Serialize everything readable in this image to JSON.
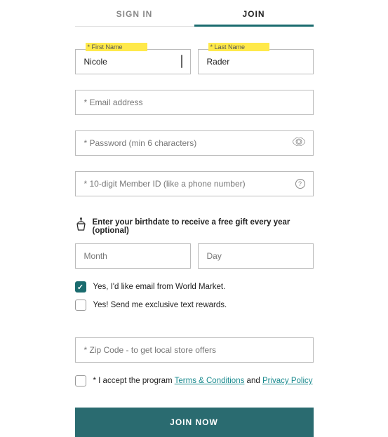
{
  "tabs": {
    "signin": "SIGN IN",
    "join": "JOIN"
  },
  "firstName": {
    "label": "* First Name",
    "value": "Nicole"
  },
  "lastName": {
    "label": "* Last Name",
    "value": "Rader"
  },
  "email": {
    "placeholder": "* Email address"
  },
  "password": {
    "placeholder": "* Password (min 6 characters)"
  },
  "memberId": {
    "placeholder": "* 10-digit Member ID (like a phone number)"
  },
  "birthday": {
    "prompt": "Enter your birthdate to receive a free gift every year (optional)",
    "month": "Month",
    "day": "Day"
  },
  "optEmail": {
    "label": "Yes, I'd like email from World Market.",
    "checked": true
  },
  "optText": {
    "label": "Yes! Send me exclusive text rewards.",
    "checked": false
  },
  "zip": {
    "placeholder": "* Zip Code - to get local store offers"
  },
  "terms": {
    "prefix": "* I accept the program ",
    "tc": "Terms & Conditions",
    "and": " and ",
    "pp": "Privacy Policy"
  },
  "submit": "JOIN NOW"
}
